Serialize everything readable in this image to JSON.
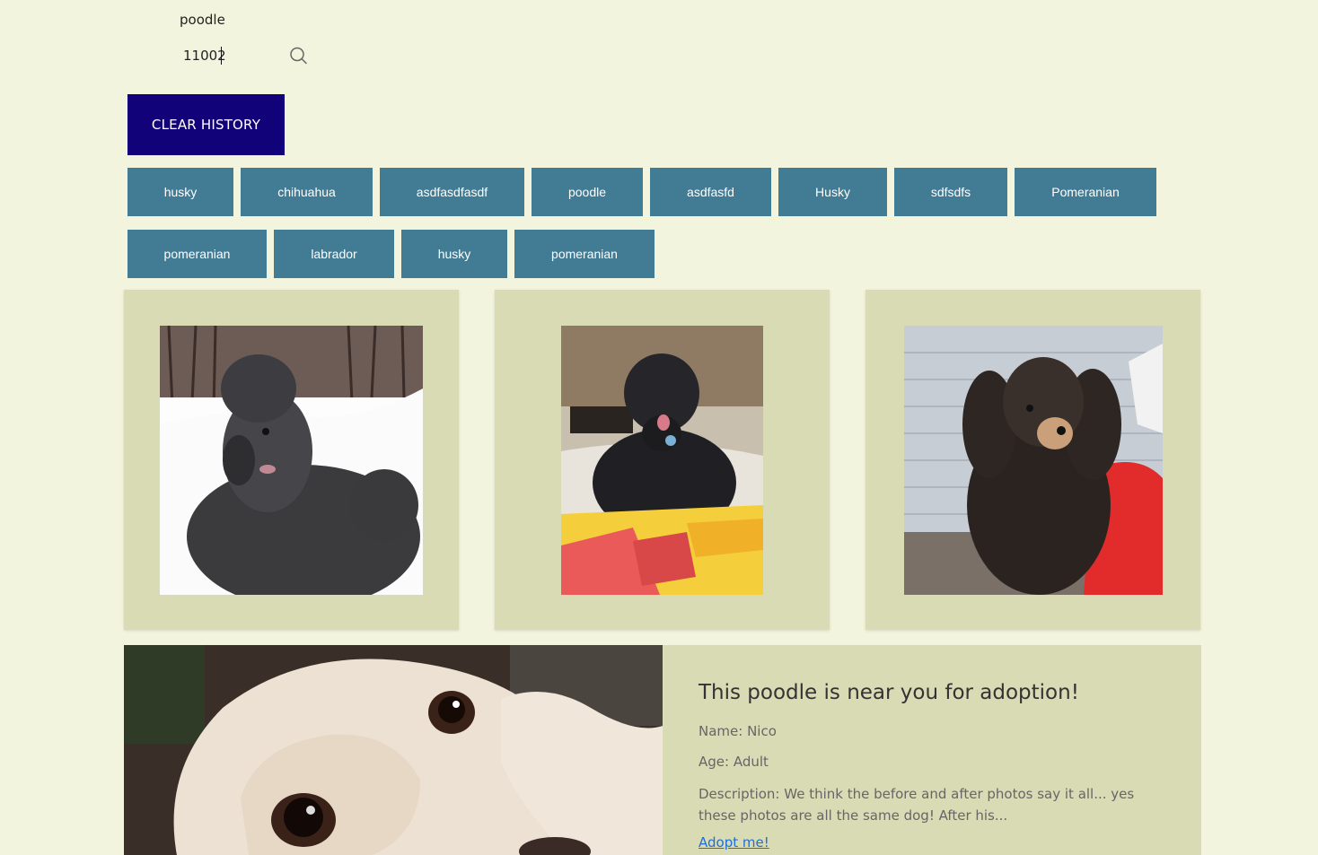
{
  "search": {
    "breed_value": "poodle",
    "zip_value": "11002"
  },
  "clear_button_label": "CLEAR HISTORY",
  "history": [
    "husky",
    "chihuahua",
    "asdfasdfasdf",
    "poodle",
    "asdfasfd",
    "Husky",
    "sdfsdfs",
    "Pomeranian",
    "pomeranian",
    "labrador",
    "husky",
    "pomeranian"
  ],
  "featured": {
    "title": "This poodle is near you for adoption!",
    "name": "Name: Nico",
    "age": "Age: Adult",
    "description": "Description: We think the before and after photos say it all... yes these photos are all the same dog! After his...",
    "link_label": "Adopt me!"
  },
  "colors": {
    "background": "#f2f4dd",
    "card": "#d9dbb5",
    "clear_button": "#12027a",
    "chip": "#427b94",
    "link": "#1e6fd9"
  },
  "icons": {
    "search": "search-icon"
  }
}
